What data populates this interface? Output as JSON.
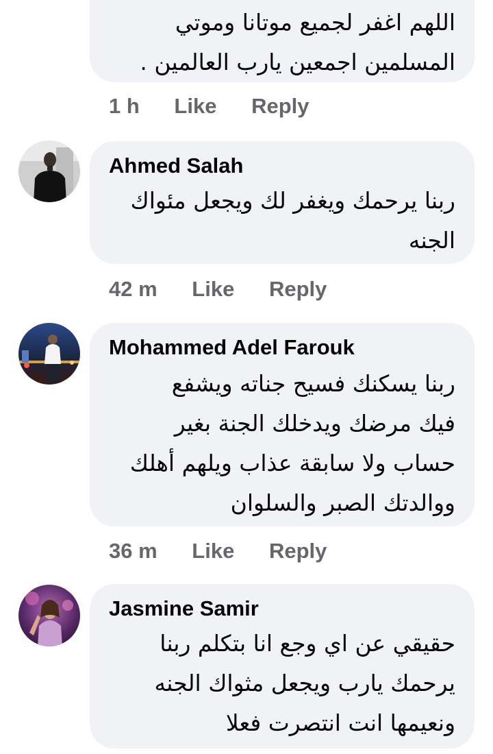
{
  "comments": [
    {
      "author": "",
      "lines": [
        "اللهم اغفر لجميع موتانا وموتي",
        "المسلمين اجمعين يارب العالمين ."
      ],
      "time": "1 h",
      "like_label": "Like",
      "reply_label": "Reply"
    },
    {
      "author": "Ahmed Salah",
      "lines": [
        "ربنا يرحمك ويغفر لك ويجعل مئواك",
        "الجنه"
      ],
      "time": "42 m",
      "like_label": "Like",
      "reply_label": "Reply"
    },
    {
      "author": "Mohammed Adel Farouk",
      "lines": [
        "ربنا يسكنك فسيح جناته ويشفع",
        "فيك مرضك ويدخلك الجنة بغير",
        "حساب ولا سابقة عذاب ويلهم أهلك",
        "ووالدتك الصبر والسلوان"
      ],
      "time": "36 m",
      "like_label": "Like",
      "reply_label": "Reply"
    },
    {
      "author": "Jasmine Samir",
      "lines": [
        "حقيقي عن اي وجع انا بتكلم ربنا",
        "يرحمك يارب ويجعل مثواك الجنه",
        "ونعيمها انت انتصرت فعلا"
      ]
    }
  ],
  "colors": {
    "bubble_bg": "#f0f2f5",
    "action_text": "#65676b",
    "text": "#050505"
  },
  "icons": {
    "avatar_1": "profile-photo-dark-person",
    "avatar_2": "profile-photo-person-night-city",
    "avatar_3": "profile-photo-purple-concert"
  }
}
